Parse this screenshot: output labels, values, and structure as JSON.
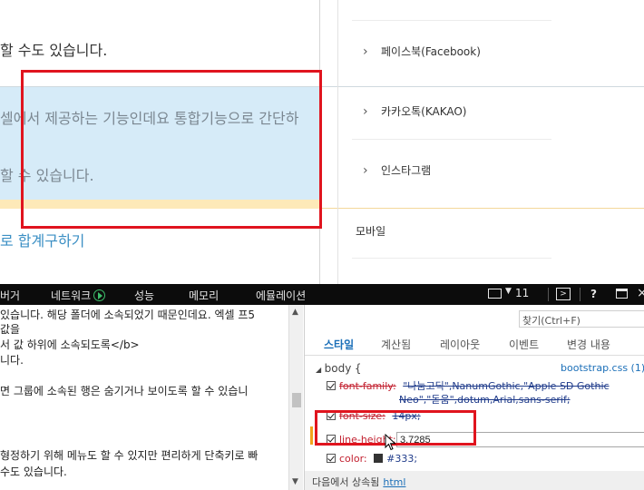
{
  "page": {
    "line1": "할 수도 있습니다.",
    "highlight_line1": "셀에서 제공하는 기능인데요 통합기능으로 간단하",
    "highlight_line2": "할 수 있습니다.",
    "link_text": "로 합계구하기"
  },
  "sidebar": {
    "items": [
      {
        "label": "페이스북(Facebook)"
      },
      {
        "label": "카카오톡(KAKAO)"
      },
      {
        "label": "인스타그램"
      }
    ],
    "mobile": "모바일"
  },
  "devtools": {
    "tabs": [
      {
        "label": "버거"
      },
      {
        "label": "네트워크"
      },
      {
        "label": "성능"
      },
      {
        "label": "메모리"
      },
      {
        "label": "에뮬레이션"
      }
    ],
    "error_count": "11",
    "find_placeholder": "찾기(Ctrl+F)",
    "source_lines": [
      "있습니다. 해당 폴더에 소속되었기 때문인데요. 엑셀 프5",
      "값을",
      "서 값 하위에 소속되도록</b>",
      "니다.",
      "",
      "면 그룹에 소속된 행은 숨기거나 보이도록 할 수 있습니",
      "",
      "형정하기 위해 메뉴도 할 수 있지만 편리하게 단축키로 빠",
      "수도 있습니다."
    ],
    "style_tabs": [
      {
        "label": "스타일"
      },
      {
        "label": "계산됨"
      },
      {
        "label": "레이아웃"
      },
      {
        "label": "이벤트"
      },
      {
        "label": "변경 내용"
      }
    ],
    "rule": {
      "selector": "body",
      "open_brace": "{",
      "source": "bootstrap.css (1)",
      "font_family_prop": "font-family:",
      "font_family_value_1": "\"나눔고딕\",NanumGothic,\"Apple SD Gothic",
      "font_family_value_2": "Neo\",\"돋움\",dotum,Arial,sans-serif;",
      "font_size_prop": "font-size:",
      "font_size_value": "14px;",
      "line_height_prop": "line-height:",
      "line_height_value": "3.7285",
      "color_prop": "color:",
      "color_value": "#333;",
      "close_brace": "}"
    },
    "inherited_label": "다음에서 상속됨",
    "inherited_link": "html"
  },
  "colors": {
    "highlight_bg": "#d6ebf8",
    "annotation_red": "#e0141e",
    "link_blue": "#3b8fc4",
    "devtools_toolbar": "#0c0c0c"
  }
}
